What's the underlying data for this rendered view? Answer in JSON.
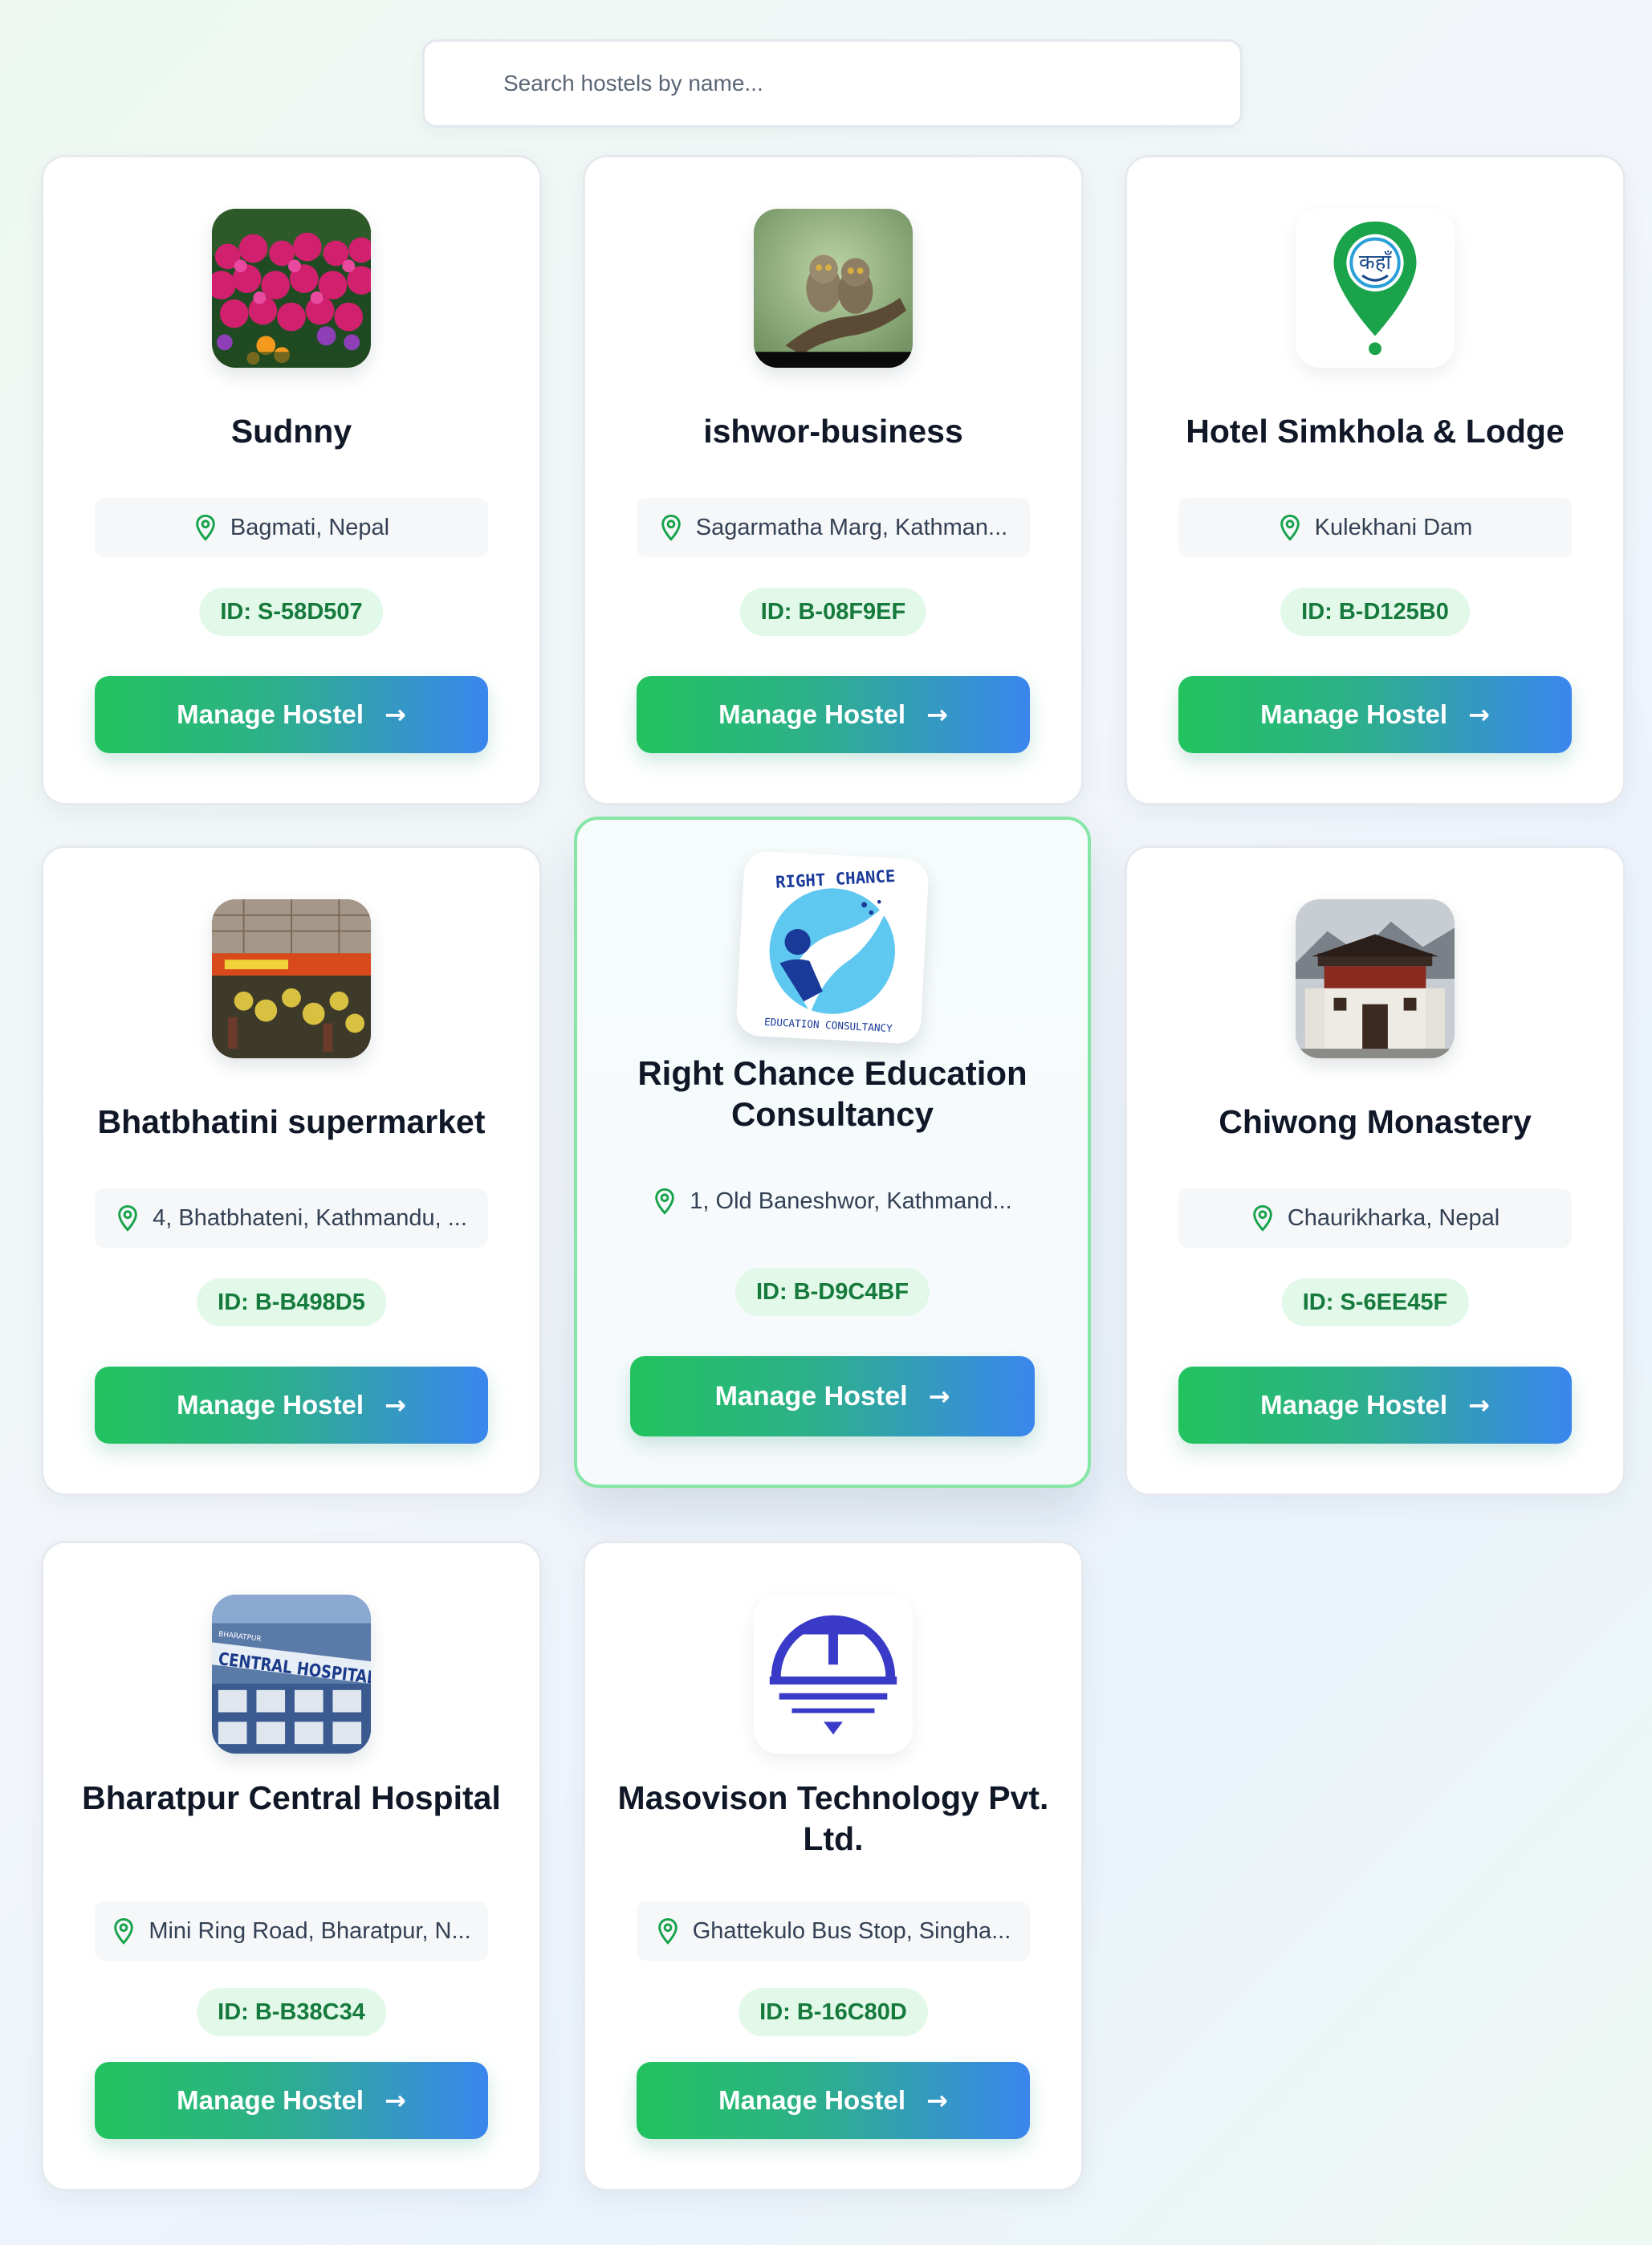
{
  "search": {
    "placeholder": "Search hostels by name..."
  },
  "hostels": [
    {
      "name": "Sudnny",
      "location": "Bagmati, Nepal",
      "id": "ID: S-58D507",
      "button": "Manage Hostel",
      "arrow": "→",
      "image": "flowers-photo"
    },
    {
      "name": "ishwor-business",
      "location": "Sagarmatha Marg, Kathman...",
      "id": "ID: B-08F9EF",
      "button": "Manage Hostel",
      "arrow": "→",
      "image": "owls-photo"
    },
    {
      "name": "Hotel Simkhola & Lodge",
      "location": "Kulekhani Dam",
      "id": "ID: B-D125B0",
      "button": "Manage Hostel",
      "arrow": "→",
      "image": "map-pin-logo",
      "logo_text": "कहाँ"
    },
    {
      "name": "Bhatbhatini supermarket",
      "location": "4, Bhatbhateni, Kathmandu, ...",
      "id": "ID: B-B498D5",
      "button": "Manage Hostel",
      "arrow": "→",
      "image": "supermarket-photo"
    },
    {
      "name": "Right Chance Education Consultancy",
      "location": "1, Old Baneshwor, Kathmand...",
      "id": "ID: B-D9C4BF",
      "button": "Manage Hostel",
      "arrow": "→",
      "image": "right-chance-logo",
      "logo_top": "RIGHT CHANCE",
      "logo_bottom": "EDUCATION CONSULTANCY"
    },
    {
      "name": "Chiwong Monastery",
      "location": "Chaurikharka, Nepal",
      "id": "ID: S-6EE45F",
      "button": "Manage Hostel",
      "arrow": "→",
      "image": "monastery-photo"
    },
    {
      "name": "Bharatpur Central Hospital",
      "location": "Mini Ring Road, Bharatpur, N...",
      "id": "ID: B-B38C34",
      "button": "Manage Hostel",
      "arrow": "→",
      "image": "hospital-photo",
      "sign_text": "CENTRAL HOSPITAL",
      "sign_small": "BHARATPUR"
    },
    {
      "name": "Masovison Technology Pvt. Ltd.",
      "location": "Ghattekulo Bus Stop, Singha...",
      "id": "ID: B-16C80D",
      "button": "Manage Hostel",
      "arrow": "→",
      "image": "masovison-logo"
    }
  ],
  "colors": {
    "accent_green": "#22c35e",
    "accent_blue": "#3a86ee",
    "badge_bg": "#e2f8e9",
    "badge_text": "#157a3c",
    "pin": "#16a34a"
  }
}
